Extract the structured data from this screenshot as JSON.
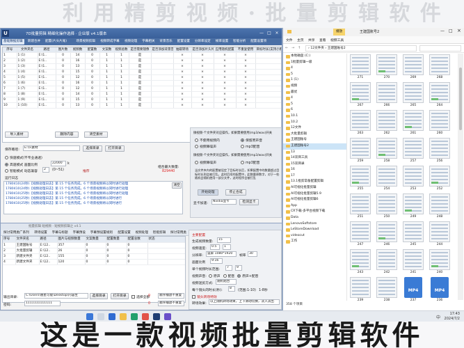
{
  "background": {
    "watermark": "利 用 精 剪 视 频 · 批 量 剪 辑 软 件"
  },
  "caption": "这是一款视频批量剪辑软件",
  "editor": {
    "title": "7D批量剪辑   精细化操作选择 · 企业版   v4.1版本",
    "tabs": [
      "基础数据剪辑",
      "新建合并",
      "配置(片头片尾)",
      "场景视频剪辑",
      "视频转成字幕",
      "视频处理",
      "字幕相关",
      "背景音乐",
      "配置设置",
      "分辨率设定",
      "帧率设置",
      "智能分析",
      "配置设置项"
    ],
    "active_tab": 0,
    "columns": [
      "序号",
      "文件夹名",
      "路径",
      "图片数",
      "视频数",
      "配置数",
      "文案数",
      "视频总数",
      "是否需要镜像",
      "是否添加背景音乐",
      "抽取转场",
      "是否添加片头片尾",
      "应用随机配置",
      "不重复使用",
      "目标时长(支持小数)"
    ],
    "rows": [
      [
        "1",
        "1 (1)",
        "E:\\1..",
        "0",
        "14",
        "0",
        "1",
        "1",
        "是",
        "",
        "×",
        "×",
        "×",
        "×",
        ""
      ],
      [
        "2",
        "1 (2)",
        "E:\\1..",
        "0",
        "16",
        "0",
        "1",
        "1",
        "是",
        "",
        "×",
        "×",
        "×",
        "×",
        ""
      ],
      [
        "3",
        "1 (3)",
        "E:\\1..",
        "0",
        "13",
        "0",
        "1",
        "1",
        "是",
        "",
        "×",
        "×",
        "×",
        "×",
        ""
      ],
      [
        "4",
        "1 (4)",
        "E:\\1..",
        "0",
        "15",
        "0",
        "1",
        "1",
        "是",
        "",
        "×",
        "×",
        "×",
        "×",
        ""
      ],
      [
        "5",
        "1 (5)",
        "E:\\1..",
        "0",
        "12",
        "0",
        "1",
        "1",
        "是",
        "",
        "×",
        "×",
        "×",
        "×",
        ""
      ],
      [
        "6",
        "1 (6)",
        "E:\\1..",
        "0",
        "16",
        "0",
        "1",
        "1",
        "是",
        "",
        "×",
        "×",
        "×",
        "×",
        ""
      ],
      [
        "7",
        "1 (7)",
        "E:\\1..",
        "0",
        "12",
        "0",
        "1",
        "1",
        "是",
        "",
        "×",
        "×",
        "×",
        "×",
        ""
      ],
      [
        "8",
        "1 (8)",
        "E:\\1..",
        "0",
        "14",
        "0",
        "1",
        "1",
        "是",
        "",
        "×",
        "×",
        "×",
        "×",
        ""
      ],
      [
        "9",
        "1 (9)",
        "E:\\1..",
        "0",
        "15",
        "0",
        "1",
        "1",
        "是",
        "",
        "×",
        "×",
        "×",
        "×",
        ""
      ],
      [
        "10",
        "1 (10)",
        "E:\\1..",
        "0",
        "13",
        "0",
        "1",
        "1",
        "是",
        "",
        "×",
        "×",
        "×",
        "×",
        ""
      ]
    ],
    "import_label": "导入素材",
    "delete_label": "删除内容",
    "clear_label": "清空素材",
    "save_path_label": "保存路径:",
    "save_path_value": "E:\\5\\素材",
    "select_dir_label": "选择目录",
    "open_dir_label": "打开目录",
    "opt1": "快速模式(不专业通透)",
    "opt2": "高速模式 画面比例",
    "ratio_value": "22000",
    "ratio_unit": "k",
    "opt3": "智能模式 动态兼容",
    "count_value": "2",
    "count_range": "(0~51)",
    "recommend": "推荐",
    "total_label": "组合最大数量:",
    "total_value": "829440",
    "log_title": "运行日志",
    "clear_log": "清空",
    "logs": [
      "1780410(24秒)【视频处理日志】第 15 个任务完成，6 个场景视频将以同时进行处理",
      "1780410(24秒)【视频处理日志】第 15 个任务完成，6 个场景视频将以同时进行处理",
      "1780410(25秒)【视频处理日志】第 15 个任务完成，6 个场景视频将以同时进行处理",
      "1780410(25秒)【视频处理日志】第 15 个任务完成，6 个场景视频将以同时进行",
      "1780410(25秒)【视频处理日志】第 15 个任务完成，6 个场景视频将以同时进行"
    ],
    "right_panel": {
      "hint1": "微视频-个文件夹对应操作，如果需要使用(mp3/wav)开关",
      "r1": "不使用视频内",
      "r2": "保留原声音",
      "r3": "视频降噪声",
      "r4": "mp3配音",
      "hint2": "微视频-个文件夹对应操作，如果需要使用(mp3/wav)开关",
      "r5": "视频降噪声",
      "r6": "mp3配音",
      "note": "当文件夹内的配置被设定了目标时长后，如果配置中的数量超过目标时长则会被打乱，此时后续的配置中，此数量原数字，对于一些随机会随机使用一部分文件，这时程序会被打乱",
      "start_label": "开始处理",
      "stop_label": "停止合成",
      "gpu_label": "显卡加速:",
      "gpu_value": "Nvidia显卡",
      "check_gpu": "检测显卡"
    }
  },
  "editor2": {
    "title": "批量剪辑   短视频 · 短视频剪辑之 v4.1",
    "tabs": [
      "探讨常用类广系列",
      "转场设置",
      "字幕与标题",
      "字幕预设",
      "字幕预设置规则",
      "配置设置",
      "视频处理",
      "智能剪辑",
      "探讨常用类",
      "探讨常用速编"
    ],
    "columns": [
      "序号",
      "文件夹名",
      "路径",
      "图片与视频数量",
      "文案数量",
      "配置数量",
      "配置总数",
      "状态"
    ],
    "rows": [
      [
        "1",
        "王建国账号",
        "E:\\12..",
        "357",
        "0",
        "0",
        "0",
        ""
      ],
      [
        "2",
        "大批量剪辑",
        "E:\\12..",
        "26",
        "0",
        "0",
        "0",
        ""
      ],
      [
        "3",
        "新建文件夹",
        "E:\\12..",
        "155",
        "0",
        "0",
        "0",
        ""
      ],
      [
        "4",
        "新建文件夹",
        "E:\\12..",
        "120",
        "0",
        "0",
        "0",
        ""
      ]
    ],
    "right": {
      "section": "主要配置",
      "gen_label": "生成视频数量:",
      "gen_value": "15",
      "speed_label": "视频速度:",
      "speed_value": "0.5",
      "speed_to": "1",
      "res_label": "分辨率:",
      "res_value": "竖屏 1080*1920",
      "fps_label": "帧率",
      "fps_value": "30",
      "ratio_label": "画面比例",
      "ratio_value": "9:16",
      "time_label": "单个视频时长范围:",
      "time_from": "7",
      "time_to": "9",
      "voice_label": "视频声音:",
      "voice_opts": [
        "原声",
        "配音",
        "原声+配音"
      ],
      "mix_label": "视频混剪方式:",
      "mix_value": "随机组合",
      "shot_label": "每个镜头的时长(秒):",
      "shot_value": "8",
      "shot_hint": "(范围:1-10)",
      "shot_max": "1-8秒",
      "chk_label": "镜头转场特效",
      "trans_label": "转场效果:",
      "trans_value": "以上随机转场效果，上下滑动切换，淡入淡出",
      "deal_label": "视频处理:",
      "deal_value": "滤镜、模糊、压缩",
      "opt_label": "视频选项:",
      "opt_value": "镜像、翻转"
    },
    "out_label": "输出目录:",
    "out_value": "C:\\Users\\朋星可能\\Desktop\\内容生",
    "out_select": "选择目录",
    "out_open": "打开目录",
    "pwd_label": "密码:",
    "pwd_value": "1111111111111",
    "sel_all": "选择全部",
    "run_label": "顺序播放不重复",
    "count_a": "0",
    "count_b": "0"
  },
  "explorer": {
    "title": "王建国账号2",
    "ribbon": [
      "文件",
      "主页",
      "共享",
      "查看"
    ],
    "tool_tab": "视频工具",
    "manage": "播放",
    "path": [
      "12文件夹",
      "王建国账号2"
    ],
    "nav": [
      "本地磁盘 (C:)",
      "1批量剪辑一级",
      "4",
      "5",
      "1 (1)",
      "视频",
      "最优",
      "4",
      "5",
      "6",
      "10.1",
      "10.2",
      "12文件",
      "大批量剪辑",
      "王建国账号",
      "王建国账号2",
      "13",
      "14双目工具",
      "15双目录",
      "16",
      "17",
      "13.1批剪常备配置剪辑",
      "AI可视化批量剪辑",
      "AI可视化批量剪辑5.9",
      "AI可视化批量剪辑6",
      "App",
      "CR下载-多平台视频下载",
      "Data",
      "LenovoSoftstore",
      "LeStoreDownload",
      "videocut",
      "工作"
    ],
    "nav_selected": 15,
    "thumbs": [
      "271",
      "270",
      "269",
      "268",
      "267",
      "266",
      "265",
      "264",
      "263",
      "262",
      "261",
      "260",
      "259",
      "258",
      "257",
      "256",
      "255",
      "254",
      "253",
      "252",
      "251",
      "250",
      "249",
      "248",
      "247",
      "246",
      "245",
      "244",
      "243",
      "242",
      "241",
      "240",
      "239",
      "238",
      "237",
      "236"
    ],
    "mp4_label": "MP4",
    "status": "358 个项目"
  },
  "taskbar": {
    "time": "17:43",
    "date": "2024/7/2",
    "lang": "中"
  }
}
